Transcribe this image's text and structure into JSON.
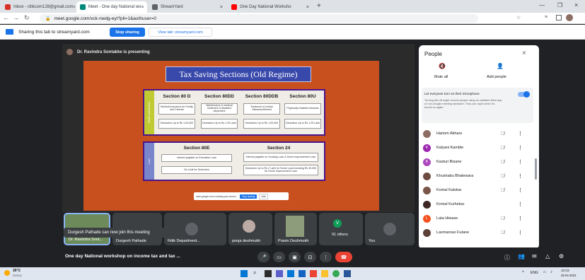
{
  "browser": {
    "tabs": [
      {
        "label": "Inbox - rdikcom128@gmail.com",
        "fav_color": "#d93025"
      },
      {
        "label": "Meet - One day National wo",
        "fav_color": "#00897b"
      },
      {
        "label": "StreamYard",
        "fav_color": "#5f6368"
      },
      {
        "label": "One Day National Worksho",
        "fav_color": "#ff0000"
      }
    ],
    "url": "meet.google.com/xck-nwdg-eyt?pli=1&authuser=0"
  },
  "share_bar": {
    "message": "Sharing this tab to streamyard.com",
    "stop_label": "Stop sharing",
    "view_label": "View tab: streamyard.com"
  },
  "meeting": {
    "presenter": "Dr. Ravindra Sontakke is presenting",
    "title": "One day National workshop on income tax and tax ..."
  },
  "slide": {
    "title": "Tax Saving Sections (Old Regime)",
    "side_label_top": "Health and Medical",
    "side_label_bottom": "Loan",
    "top_sections": [
      {
        "heading": "Section 80 D",
        "desc": "Medical Insurance for Family and Parents",
        "limit": "Deduction Up to Rs 1,00,000"
      },
      {
        "heading": "Section 80DD",
        "desc": "Maintenance & medical treatment of disabled dependent",
        "limit": "Deduction Up to Rs 1.25 Lakh"
      },
      {
        "heading": "Section 80DDB",
        "desc": "Treatment of certain Diseases/Ailment",
        "limit": "Deduction Up to Rs 1,00,000"
      },
      {
        "heading": "Section 80U",
        "desc": "Physically Disabled Assesse",
        "limit": "Deduction Up to Rs 1.25 Lakh"
      }
    ],
    "bottom_sections": [
      {
        "heading": "Section 80E",
        "line1": "Interest payable on Education Loan",
        "line2": "No Limit for Deduction"
      },
      {
        "heading": "Section 24",
        "line1": "Interest payable on Housing Loan & Home Improvement Loan",
        "line2": "Deduction Up to Rs 2 Lakh for Home Loan including Rs 30,000 for Home Improvement Loan"
      }
    ],
    "share_notice": "meet.google.com is sharing your screen.",
    "share_stop": "Stop sharing",
    "share_hide": "Hide"
  },
  "people_panel": {
    "title": "People",
    "mute_all": "Mute all",
    "add_people": "Add people",
    "toggle_label": "Let everyone turn on their microphone",
    "toggle_desc": "Turning this off might remove people using an outdated Meet app or non-Google meeting hardware. They can rejoin when it's turned on again.",
    "participants": [
      {
        "name": "Hariom Akhare",
        "avatar": "",
        "color": "#8d6e63"
      },
      {
        "name": "Kalyani Kamble",
        "avatar": "K",
        "color": "#9c27b0"
      },
      {
        "name": "Kasturi Bisane",
        "avatar": "K",
        "color": "#ab47bc"
      },
      {
        "name": "Khushabu Bhalewara",
        "avatar": "",
        "color": "#6d4c41"
      },
      {
        "name": "Komal Kalskar",
        "avatar": "",
        "color": "#795548"
      },
      {
        "name": "Komal Kurhekar",
        "avatar": "",
        "color": "#3e2723"
      },
      {
        "name": "Lata Hiwase",
        "avatar": "L",
        "color": "#f4511e"
      },
      {
        "name": "Laxmanrao Futane",
        "avatar": "",
        "color": "#5d4037"
      }
    ]
  },
  "tiles": [
    {
      "name": "Dr. Ravindra Sont...",
      "avatar": ""
    },
    {
      "name": "Durgesh Pathade",
      "avatar": ""
    },
    {
      "name": "Rdik Department...",
      "avatar": ""
    },
    {
      "name": "pooja deshmukh",
      "avatar": ""
    },
    {
      "name": "Pravin Deshmukh",
      "avatar": ""
    },
    {
      "name": "91 others",
      "avatar": "V"
    },
    {
      "name": "You",
      "avatar": ""
    }
  ],
  "toast": "Durgesh Pathade can now join this meeting",
  "taskbar": {
    "temp": "36°C",
    "weather": "Sunny",
    "lang": "ENG",
    "time": "10:03",
    "date": "26-04-2022"
  }
}
